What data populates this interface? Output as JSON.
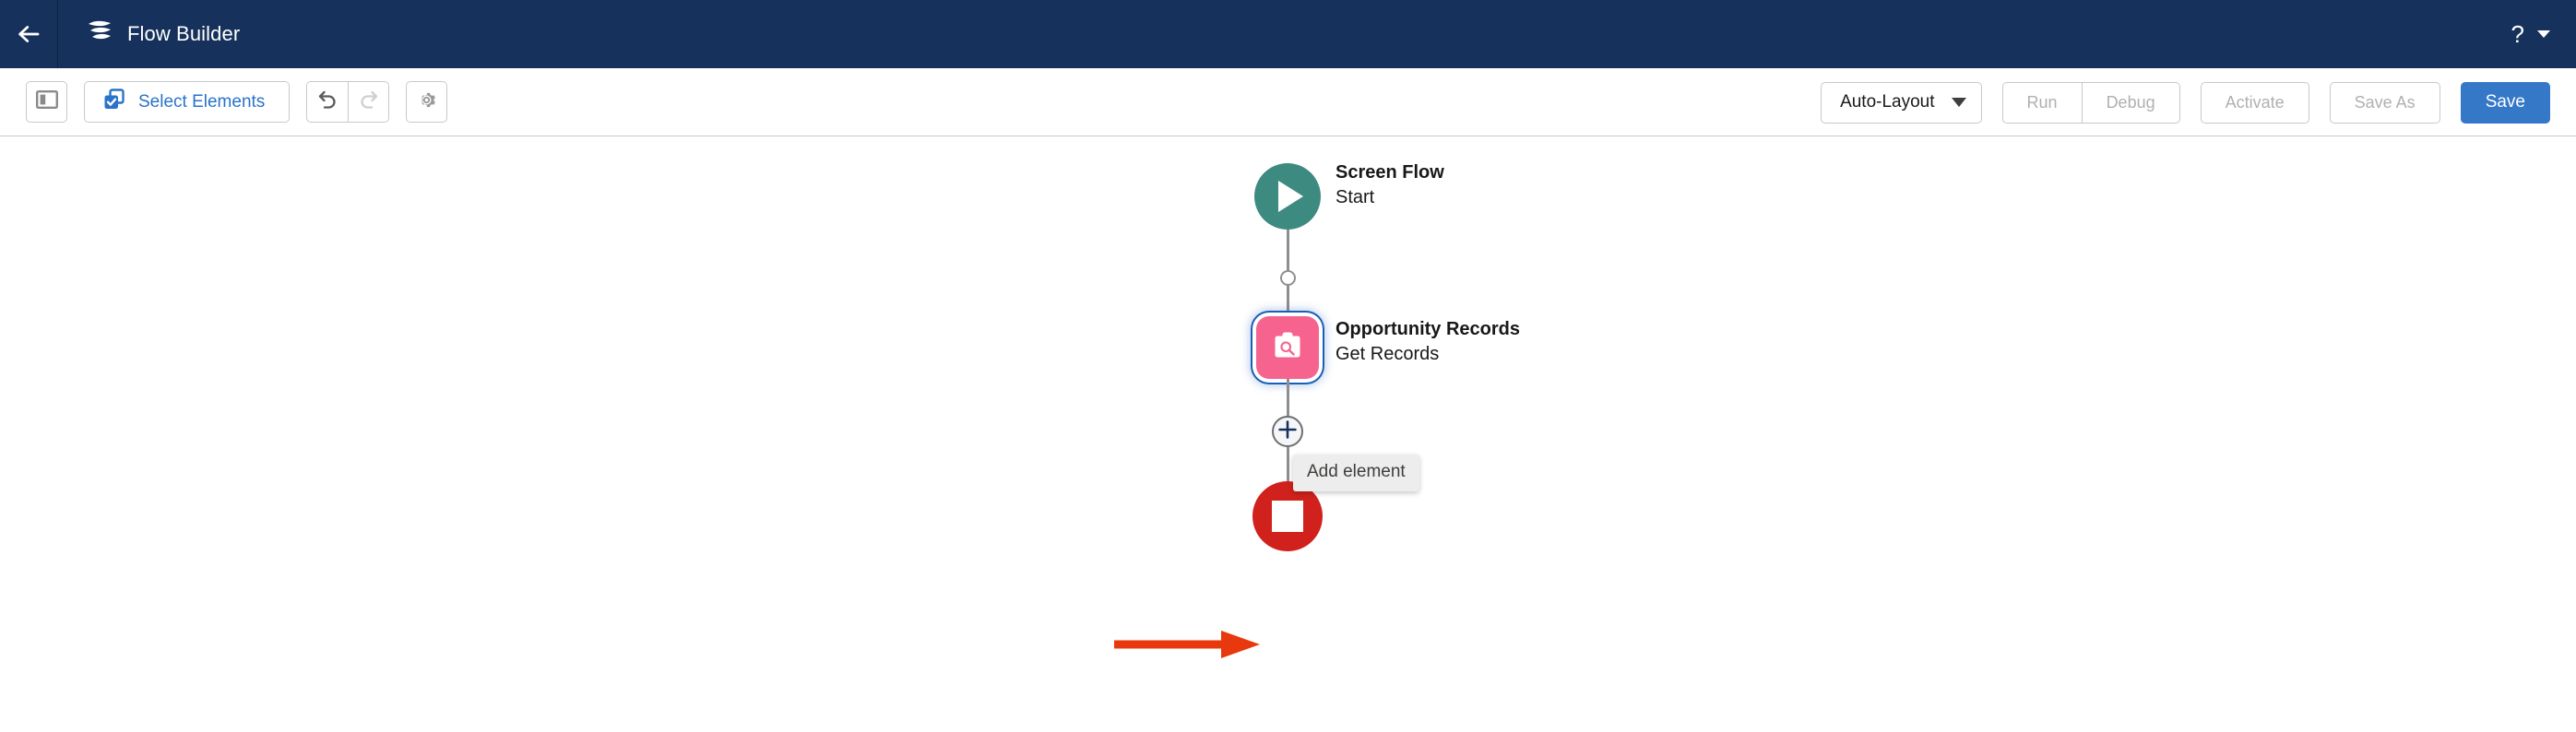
{
  "header": {
    "back_icon": "arrow-left-icon",
    "brand_icon": "flow-builder-logo-icon",
    "title": "Flow Builder",
    "help_icon": "question-mark-icon",
    "help_caret_icon": "chevron-down-icon"
  },
  "toolbar": {
    "panel_toggle_icon": "toggle-left-panel-icon",
    "select_elements_icon": "multi-select-icon",
    "select_elements_label": "Select Elements",
    "undo_icon": "undo-icon",
    "redo_icon": "redo-icon",
    "settings_icon": "gear-icon",
    "layout_mode": "Auto-Layout",
    "layout_caret_icon": "chevron-down-icon",
    "run_label": "Run",
    "debug_label": "Debug",
    "activate_label": "Activate",
    "save_as_label": "Save As",
    "save_label": "Save"
  },
  "canvas": {
    "nodes": [
      {
        "id": "start",
        "icon": "play-icon",
        "title": "Screen Flow",
        "subtitle": "Start",
        "color": "#3d8a81"
      },
      {
        "id": "get-records",
        "icon": "get-records-clipboard-search-icon",
        "title": "Opportunity Records",
        "subtitle": "Get Records",
        "color": "#f5638e",
        "selected": true
      },
      {
        "id": "end",
        "icon": "stop-icon",
        "title": "",
        "subtitle": "",
        "color": "#d0211c"
      }
    ],
    "add_element_icon": "plus-icon",
    "tooltip_text": "Add element",
    "annotation_color": "#e8380d"
  }
}
